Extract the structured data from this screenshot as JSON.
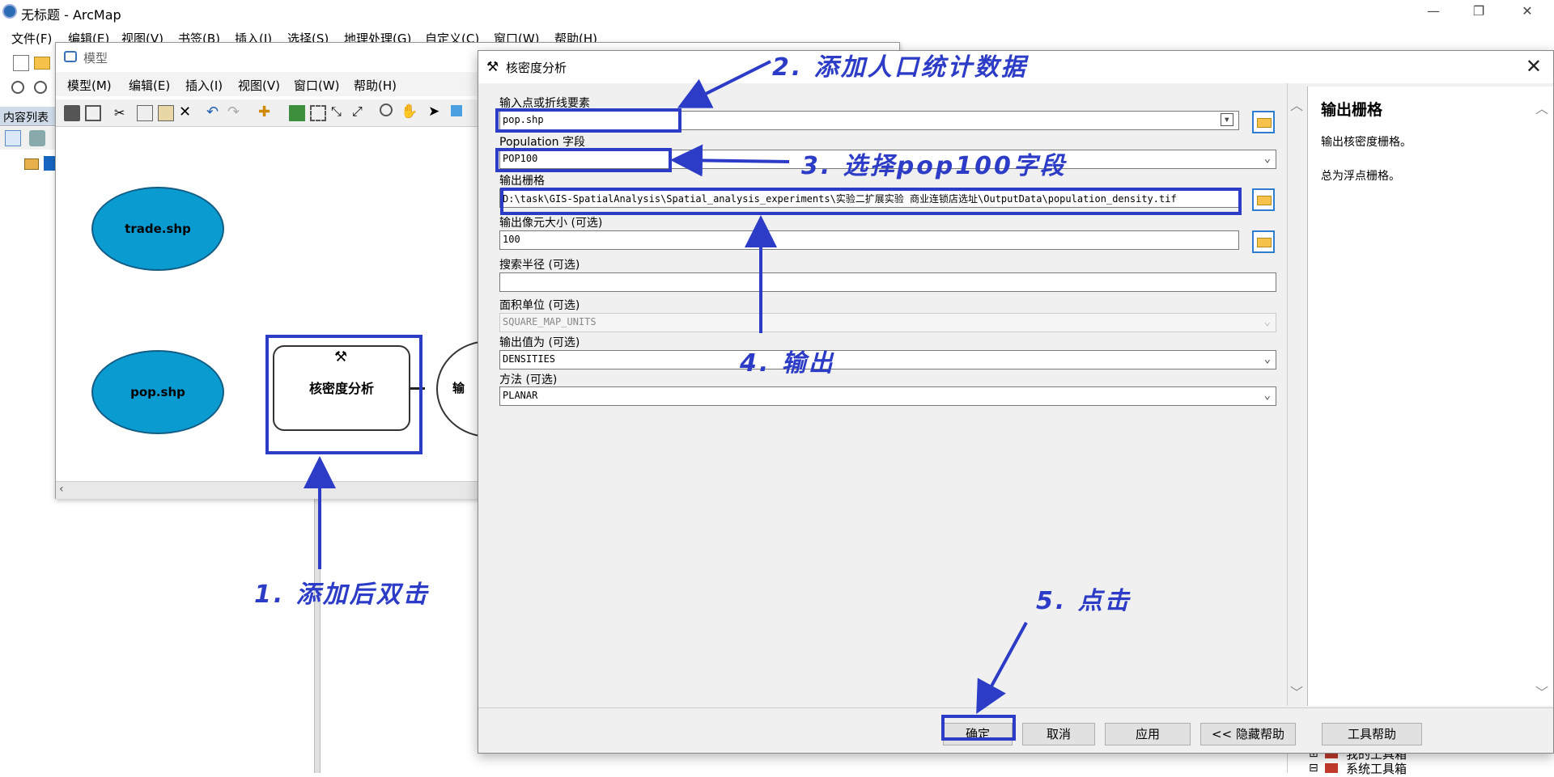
{
  "app": {
    "title": "无标题 - ArcMap"
  },
  "main_menu": [
    "文件(F)",
    "编辑(E)",
    "视图(V)",
    "书签(B)",
    "插入(I)",
    "选择(S)",
    "地理处理(G)",
    "自定义(C)",
    "窗口(W)",
    "帮助(H)"
  ],
  "toc": {
    "title": "内容列表"
  },
  "model_window": {
    "title": "模型",
    "menu": [
      "模型(M)",
      "编辑(E)",
      "插入(I)",
      "视图(V)",
      "窗口(W)",
      "帮助(H)"
    ],
    "nodes": {
      "trade": "trade.shp",
      "pop": "pop.shp",
      "tool": "核密度分析",
      "output_partial": "输"
    }
  },
  "dialog": {
    "title": "核密度分析",
    "fields": {
      "input_label": "输入点或折线要素",
      "input_value": "pop.shp",
      "pop_label": "Population 字段",
      "pop_value": "POP100",
      "out_label": "输出栅格",
      "out_value": "D:\\task\\GIS-SpatialAnalysis\\Spatial_analysis_experiments\\实验二扩展实验 商业连锁店选址\\OutputData\\population_density.tif",
      "cell_label": "输出像元大小 (可选)",
      "cell_value": "100",
      "radius_label": "搜索半径 (可选)",
      "radius_value": "",
      "area_label": "面积单位 (可选)",
      "area_value": "SQUARE_MAP_UNITS",
      "values_label": "输出值为 (可选)",
      "values_value": "DENSITIES",
      "method_label": "方法 (可选)",
      "method_value": "PLANAR"
    },
    "help": {
      "title": "输出栅格",
      "line1": "输出核密度栅格。",
      "line2": "总为浮点栅格。"
    },
    "buttons": {
      "ok": "确定",
      "cancel": "取消",
      "apply": "应用",
      "hide_help": "<< 隐藏帮助",
      "tool_help": "工具帮助"
    }
  },
  "annotations": {
    "step1": "1. 添加后双击",
    "step2": "2. 添加人口统计数据",
    "step3": "3. 选择pop100字段",
    "step4": "4. 输出",
    "step5": "5. 点击"
  },
  "background_tree": {
    "item1": "我的工具箱",
    "item2": "系统工具箱"
  },
  "colors": {
    "annotation": "#2c3cc7",
    "ellipse_fill": "#0a9bd0"
  }
}
